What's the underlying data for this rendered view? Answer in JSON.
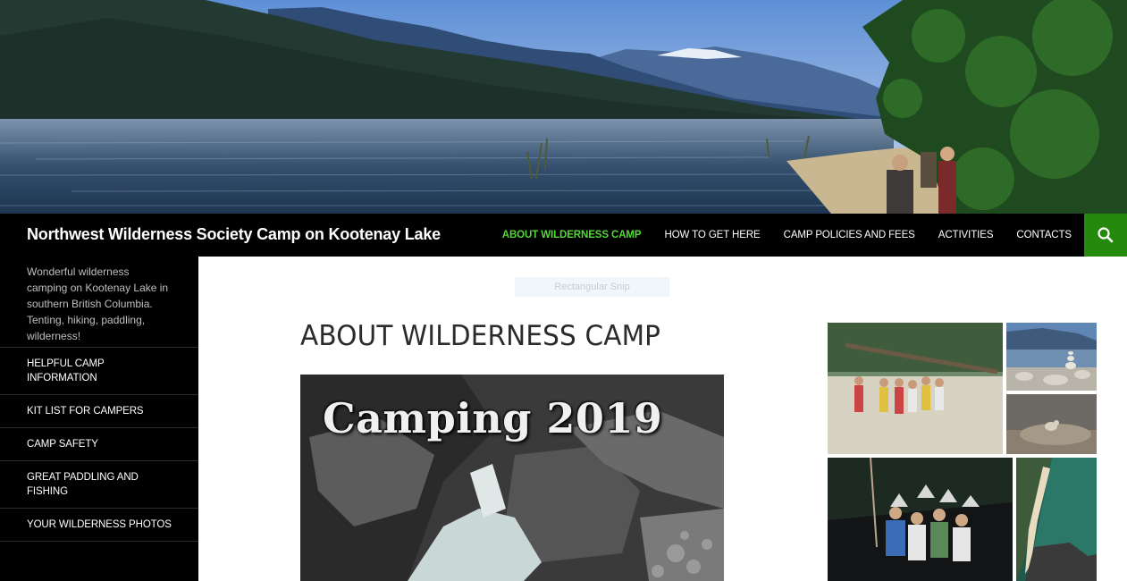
{
  "site": {
    "title": "Northwest Wilderness Society Camp on Kootenay Lake",
    "description": "Wonderful wilderness camping on Kootenay Lake in southern British Columbia. Tenting, hiking, paddling, wilderness!"
  },
  "nav": {
    "items": [
      {
        "label": "ABOUT WILDERNESS CAMP",
        "active": true
      },
      {
        "label": "HOW TO GET HERE"
      },
      {
        "label": "CAMP POLICIES AND FEES"
      },
      {
        "label": "ACTIVITIES"
      },
      {
        "label": "CONTACTS"
      }
    ],
    "search_icon": "search-icon"
  },
  "sidebar": {
    "items": [
      {
        "label": "HELPFUL CAMP INFORMATION"
      },
      {
        "label": "KIT LIST FOR CAMPERS"
      },
      {
        "label": "CAMP SAFETY"
      },
      {
        "label": "GREAT PADDLING AND FISHING"
      },
      {
        "label": "YOUR WILDERNESS PHOTOS"
      }
    ]
  },
  "overlay": {
    "snip_label": "Rectangular Snip"
  },
  "main": {
    "page_title": "ABOUT WILDERNESS CAMP",
    "feature_caption": "Camping 2019"
  },
  "colors": {
    "accent": "#24890d",
    "active_nav": "#55d737",
    "bar": "#000000"
  }
}
